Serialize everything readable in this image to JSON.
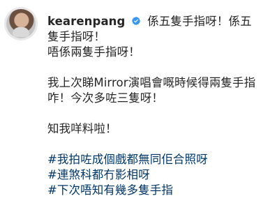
{
  "post": {
    "username": "kearenpang",
    "caption_line_1": "係五隻手指呀！係五隻手指呀！",
    "caption_line_2": "唔係兩隻手指呀！",
    "caption_line_3": "我上次睇Mirror演唱會嘅時候得兩隻手指咋！今次多咗三隻呀！",
    "caption_line_4": "知我咩料啦！",
    "hashtags": [
      "#我拍咗成個戲都無同佢合照呀",
      "#連煞科都冇影相呀",
      "#下次唔知有幾多隻手指"
    ]
  },
  "colors": {
    "text": "#262626",
    "hashtag": "#00376b",
    "verified": "#3897f0"
  },
  "icons": {
    "verified": "verified-badge-icon",
    "avatar": "profile-avatar"
  }
}
